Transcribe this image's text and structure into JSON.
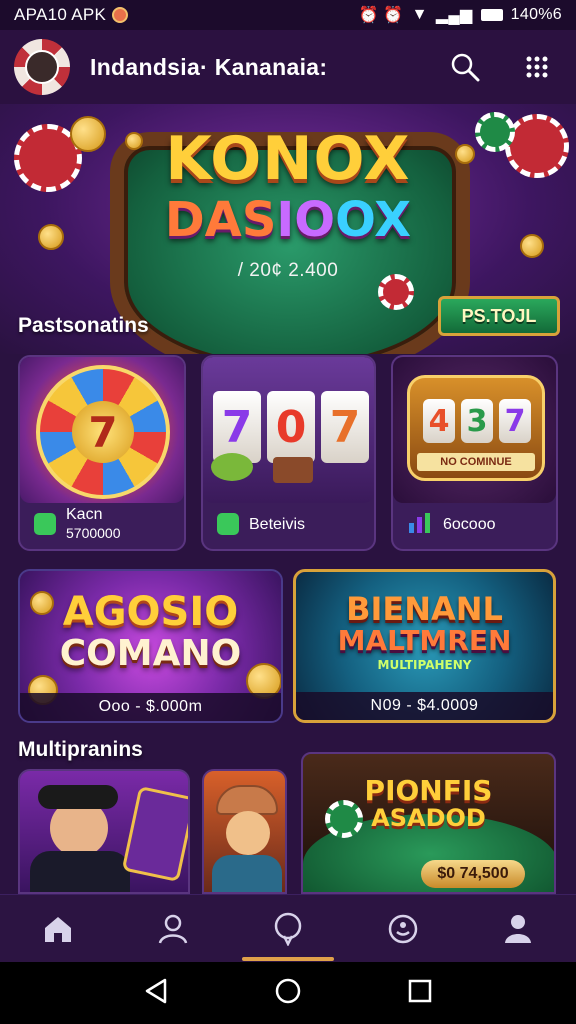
{
  "status_bar": {
    "left_text": "APA10 APK",
    "right_text": "140%6"
  },
  "header": {
    "title": "Indandsia· Kananaia:",
    "icons": [
      "search-icon",
      "grid-menu-icon"
    ]
  },
  "hero": {
    "title_line1": "KONOX",
    "title_line2_a": "DAS",
    "title_line2_b": "IO",
    "title_line2_c": "OX",
    "subtitle": "/ 20¢ 2.400",
    "button_label": "PS.TOJL"
  },
  "section1": {
    "label": "Pastsonatins",
    "cards": [
      {
        "art_text": "7",
        "icon": "green-square-icon",
        "line1": "Kacn",
        "line2": "5700000"
      },
      {
        "art_reels": [
          "7",
          "0",
          "7"
        ],
        "icon": "green-square-icon",
        "line1": "Beteivis",
        "line2": ""
      },
      {
        "art_reels": [
          "4",
          "3",
          "7"
        ],
        "art_caption": "NO COMINUE",
        "icon": "chart-icon",
        "line1": "6ocooo",
        "line2": ""
      }
    ]
  },
  "banners": [
    {
      "line1": "AGOSIO",
      "line2": "COMANO",
      "footer": "Ooo - $.000m"
    },
    {
      "line1": "BIENANL",
      "line2": "MALTMREN",
      "line3": "MULTIPAHENY",
      "footer": "N09 - $4.0009"
    }
  ],
  "section2": {
    "label": "Multipranins",
    "tile3": {
      "title1": "PIONFIS",
      "title2": "ASADOD",
      "value": "$0 74,500"
    }
  },
  "bottom_nav": [
    "home-icon",
    "people-icon",
    "chat-bubble-icon",
    "smile-face-icon",
    "user-icon"
  ],
  "system_nav": [
    "back-icon",
    "home-circle-icon",
    "recents-icon"
  ],
  "colors": {
    "accent": "#e0a24a",
    "background": "#2a1240",
    "card": "#3b1d5a"
  }
}
